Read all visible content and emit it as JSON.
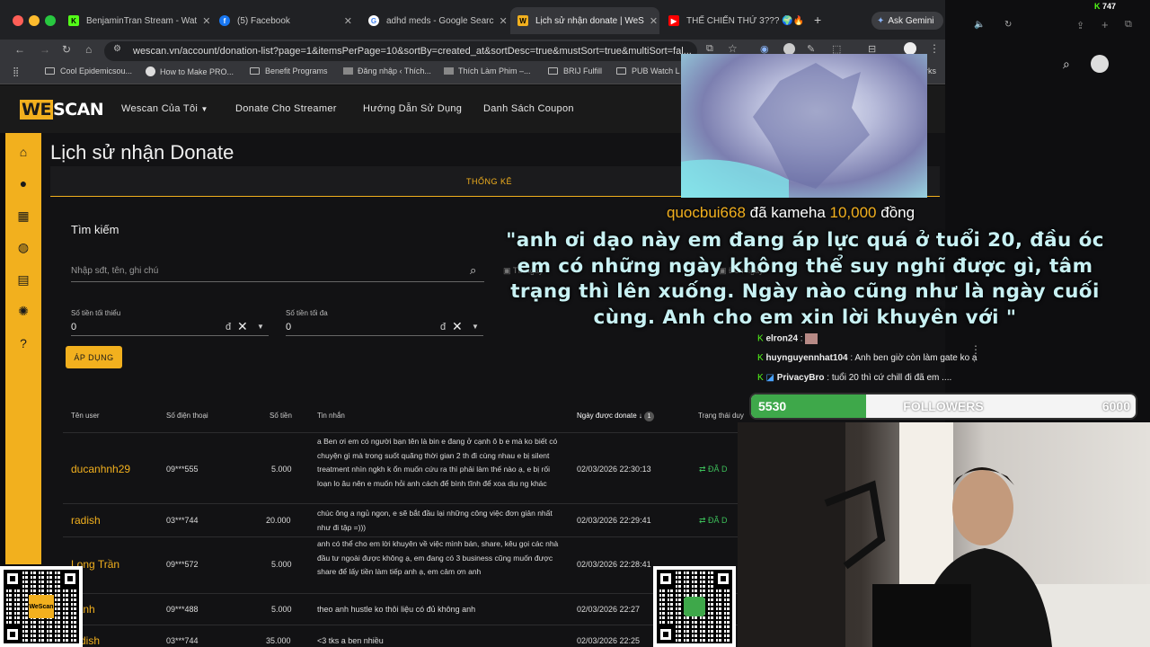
{
  "browser": {
    "tabs": [
      {
        "title": "BenjaminTran Stream - Wat",
        "icon": "kick-icon",
        "color": "#53fc18"
      },
      {
        "title": "(5) Facebook",
        "icon": "facebook-icon",
        "color": "#1877f2"
      },
      {
        "title": "adhd meds - Google Searc",
        "icon": "google-icon",
        "color": "#ffffff"
      },
      {
        "title": "Lịch sử nhận donate | WeS",
        "icon": "wescan-icon",
        "color": "#f2b01e"
      },
      {
        "title": "THẾ CHIẾN THỨ 3??? 🌍🔥",
        "icon": "youtube-icon",
        "color": "#ff0000"
      }
    ],
    "new_tab": "+",
    "ask_gemini": "Ask Gemini",
    "url": "wescan.vn/account/donation-list?page=1&itemsPerPage=10&sortBy=created_at&sortDesc=true&mustSort=true&multiSort=fal...",
    "bookmarks": [
      "Cool Epidemicsou...",
      "How to Make PRO...",
      "Benefit Programs",
      "Đăng nhập ‹ Thích...",
      "Thích Làm Phim –...",
      "BRIJ Fulfill",
      "PUB Watch L",
      "rks"
    ],
    "mac_status_count": "747"
  },
  "site": {
    "logo": "WeScan",
    "nav": [
      "Wescan Của Tôi",
      "Donate Cho Streamer",
      "Hướng Dẫn Sử Dụng",
      "Danh Sách Coupon"
    ],
    "page_title": "Lịch sử nhận Donate",
    "stats_tab": "THỐNG KÊ",
    "search_heading": "Tìm kiếm",
    "search_placeholder": "Nhập sđt, tên, ghi chú",
    "date_placeholder_from": "Từ ngày",
    "date_placeholder_to": "Đến ngày",
    "min_label": "Số tiền tối thiểu",
    "min_value": "0",
    "max_label": "Số tiền tối đa",
    "max_value": "0",
    "currency": "đ",
    "apply_button": "ÁP DỤNG",
    "columns": [
      "Tên user",
      "Số điện thoại",
      "Số tiền",
      "Tin nhắn",
      "Ngày được donate",
      "Trạng thái duy"
    ],
    "sort_badge": "1",
    "status_label": "ĐÃ D",
    "rows": [
      {
        "user": "ducanhnh29",
        "phone": "09***555",
        "amount": "5.000",
        "message": "a Ben ơi em có người bạn tên là bin e đang ở cạnh ô b e mà ko biết có chuyện gì mà trong suốt quãng thời gian 2 th đi cùng nhau e bị silent treatment nhìn ngkh k ổn muốn cứu ra thì phải làm thế nào ạ, e bị rối loạn lo âu nên e muốn hỏi anh cách để bình tĩnh để xoa dịu ng khác",
        "date": "02/03/2026 22:30:13"
      },
      {
        "user": "radish",
        "phone": "03***744",
        "amount": "20.000",
        "message": "chúc ông a ngủ ngon, e sẽ bắt đầu lại những công việc đơn giản nhất như đi tập =)))",
        "date": "02/03/2026 22:29:41"
      },
      {
        "user": "Long Trần",
        "phone": "09***572",
        "amount": "5.000",
        "message": "anh có thể cho em lời khuyên về việc mình bán, share, kêu gọi các nhà đầu tư ngoài được không ạ, em đang có 3 business cũng muốn được share để lấy tiền làm tiếp anh ạ, em cảm ơn anh",
        "date": "02/03/2026 22:28:41"
      },
      {
        "user": "hánh",
        "phone": "09***488",
        "amount": "5.000",
        "message": "theo anh hustle ko thôi liệu có đủ không anh",
        "date": "02/03/2026 22:27"
      },
      {
        "user": "dish",
        "phone": "03***744",
        "amount": "35.000",
        "message": "<3 tks a ben nhiều",
        "date": "02/03/2026 22:25"
      }
    ]
  },
  "stream": {
    "donor": "quocbui668",
    "action": "đã kameha",
    "amount": "10,000",
    "unit": "đồng",
    "donation_message": "\"anh ơi dạo này em đang áp lực quá ở tuổi 20, đầu óc em có những ngày không thể suy nghĩ được gì, tâm trạng thì lên xuống. Ngày nào cũng như là ngày cuối cùng. Anh cho em xin lời khuyên với \"",
    "chat": [
      {
        "user": "elron24",
        "text": ""
      },
      {
        "user": "huynguyennhat104",
        "text": "Anh ben giờ còn làm gate ko ạ"
      },
      {
        "user": "PrivacyBro",
        "text": "tuổi 20 thì cứ chill đi đã em ...."
      }
    ],
    "followers_current": "5530",
    "followers_label": "FOLLOWERS",
    "followers_goal": "6000",
    "followers_progress": 0.3,
    "qr_logo": "WeScan"
  }
}
